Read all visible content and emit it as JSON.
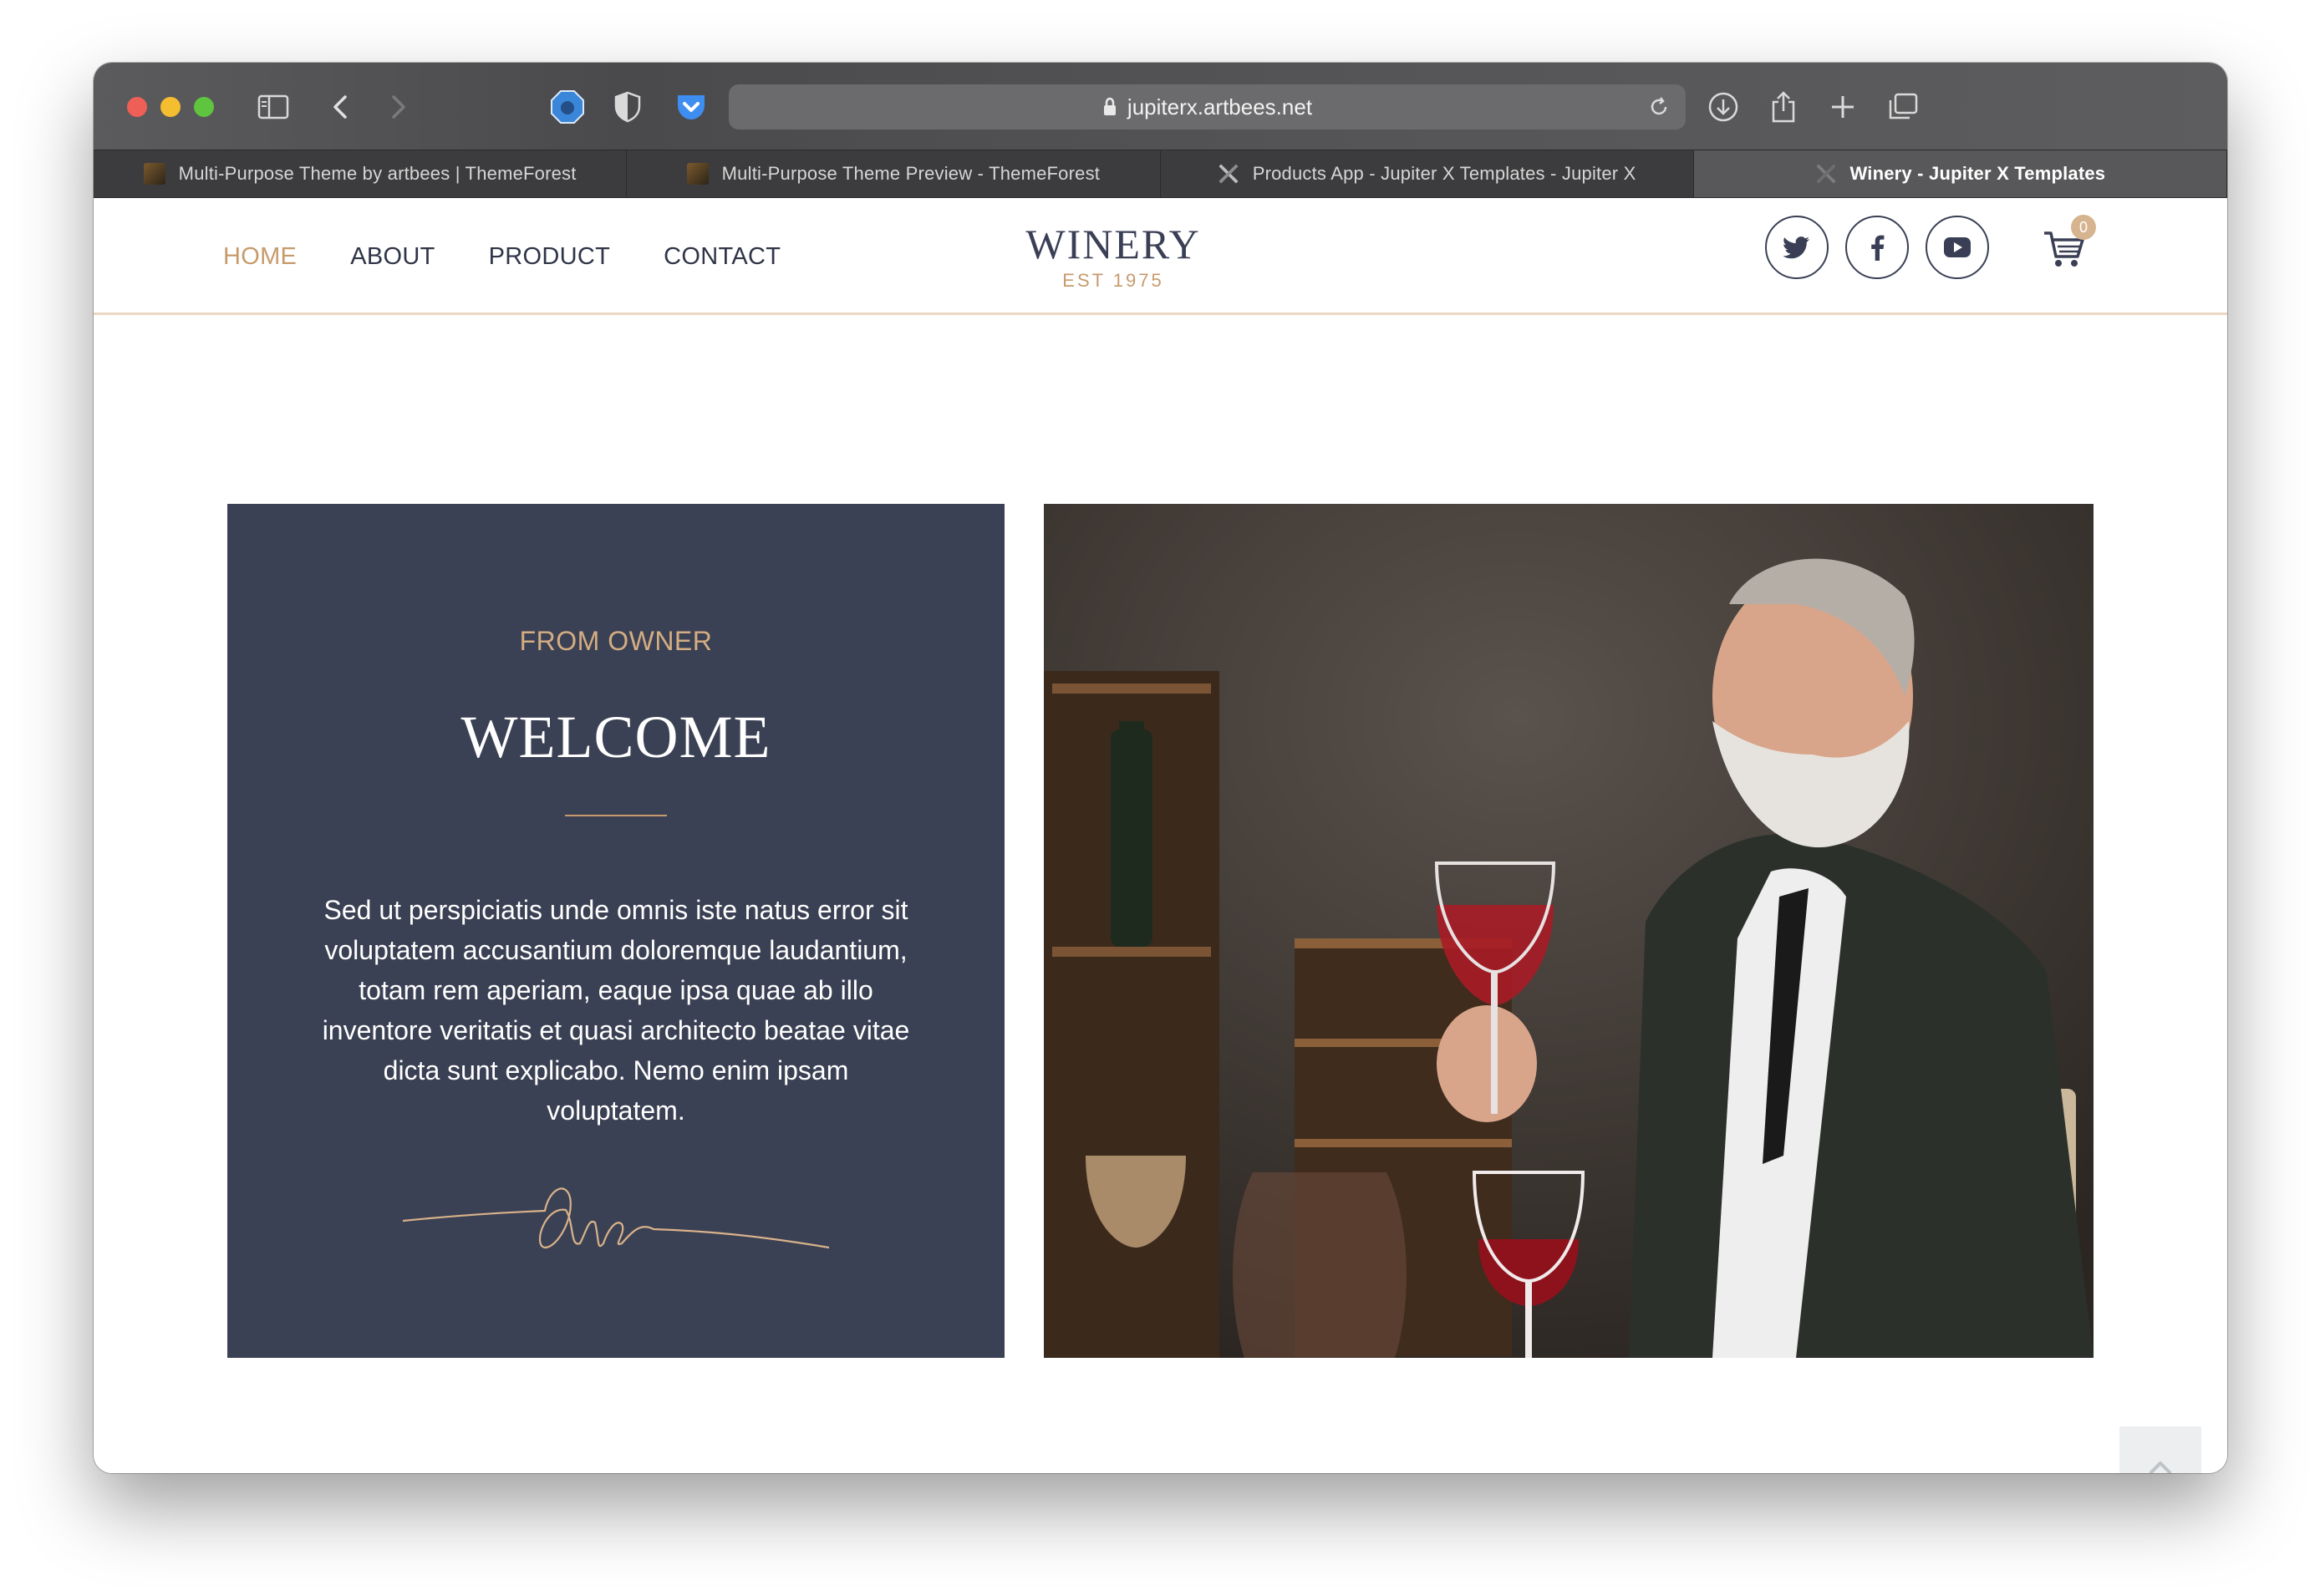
{
  "browser": {
    "url": "jupiterx.artbees.net",
    "tabs": [
      {
        "label": "Multi-Purpose Theme by artbees | ThemeForest",
        "icon": "themeforest-icon",
        "active": false
      },
      {
        "label": "Multi-Purpose Theme Preview - ThemeForest",
        "icon": "themeforest-icon",
        "active": false
      },
      {
        "label": "Products App - Jupiter X Templates - Jupiter X",
        "icon": "jupiterx-icon",
        "active": false
      },
      {
        "label": "Winery - Jupiter X Templates",
        "icon": "jupiterx-icon",
        "active": true
      }
    ]
  },
  "nav": {
    "items": [
      "HOME",
      "ABOUT",
      "PRODUCT",
      "CONTACT"
    ],
    "active": "HOME"
  },
  "logo": {
    "name": "WINERY",
    "tagline": "EST 1975"
  },
  "social": [
    "twitter-icon",
    "facebook-icon",
    "youtube-icon"
  ],
  "cart": {
    "count": "0"
  },
  "owner": {
    "eyebrow": "FROM OWNER",
    "title": "WELCOME",
    "body": "Sed ut perspiciatis unde omnis iste natus error sit voluptatem accusantium doloremque laudantium, totam rem aperiam, eaque ipsa quae ab illo inventore veritatis et quasi architecto beatae vitae dicta sunt explicabo. Nemo enim ipsam voluptatem."
  },
  "colors": {
    "accent": "#c79a6c",
    "card": "#3b4154",
    "text_dark": "#2f3447"
  }
}
